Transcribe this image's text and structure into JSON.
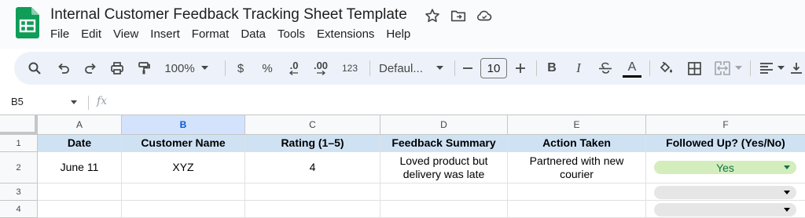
{
  "document": {
    "title": "Internal Customer Feedback Tracking Sheet Template"
  },
  "menu": [
    "File",
    "Edit",
    "View",
    "Insert",
    "Format",
    "Data",
    "Tools",
    "Extensions",
    "Help"
  ],
  "toolbar": {
    "zoom": "100%",
    "currency": "$",
    "percent": "%",
    "decrease_decimal": ".0",
    "increase_decimal": ".00",
    "number_format": "123",
    "font": "Defaul...",
    "font_size": "10",
    "bold": "B",
    "italic": "I",
    "text_color_letter": "A"
  },
  "formula_bar": {
    "name_box": "B5",
    "fx": "fx"
  },
  "columns": [
    "A",
    "B",
    "C",
    "D",
    "E",
    "F"
  ],
  "selected_column": "B",
  "rows": [
    "1",
    "2",
    "3",
    "4"
  ],
  "table": {
    "headers": [
      "Date",
      "Customer Name",
      "Rating (1–5)",
      "Feedback Summary",
      "Action Taken",
      "Followed Up? (Yes/No)"
    ],
    "row2": {
      "date": "June 11",
      "customer": "XYZ",
      "rating": "4",
      "feedback": "Loved product but delivery was late",
      "action": "Partnered with new courier",
      "followed_up": "Yes"
    }
  },
  "colors": {
    "header_fill": "#cfe2f3",
    "selected_column": "#d3e3fd",
    "yes_chip": "#d4edbc",
    "yes_text": "#11734b",
    "sheets_green": "#0f9d58"
  }
}
